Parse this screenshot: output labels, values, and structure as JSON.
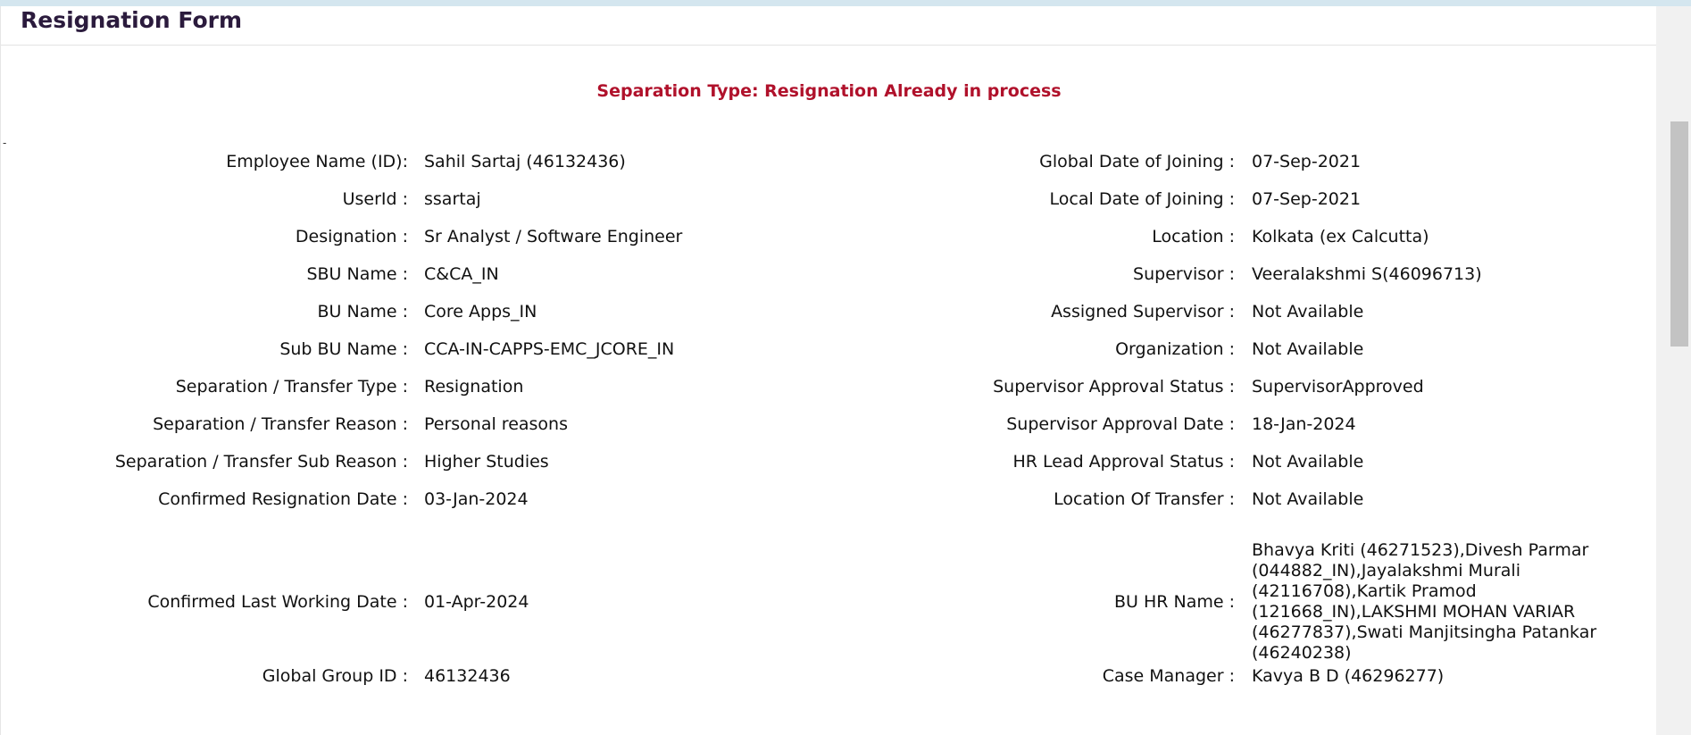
{
  "form": {
    "title": "Resignation Form",
    "status_banner": "Separation Type: Resignation Already in process",
    "tiny_mark": "-"
  },
  "left": [
    {
      "label": "Employee Name (ID):",
      "value": "Sahil Sartaj (46132436)"
    },
    {
      "label": "UserId :",
      "value": "ssartaj"
    },
    {
      "label": "Designation :",
      "value": "Sr Analyst / Software Engineer"
    },
    {
      "label": "SBU Name :",
      "value": "C&CA_IN"
    },
    {
      "label": "BU Name :",
      "value": "Core Apps_IN"
    },
    {
      "label": "Sub BU Name :",
      "value": "CCA-IN-CAPPS-EMC_JCORE_IN"
    },
    {
      "label": "Separation / Transfer Type :",
      "value": "Resignation"
    },
    {
      "label": "Separation / Transfer Reason :",
      "value": "Personal reasons"
    },
    {
      "label": "Separation / Transfer Sub Reason :",
      "value": "Higher Studies"
    },
    {
      "label": "Confirmed Resignation Date :",
      "value": "03-Jan-2024"
    },
    {
      "label": "Confirmed Last Working Date :",
      "value": "01-Apr-2024"
    },
    {
      "label": "Global Group ID :",
      "value": "46132436"
    }
  ],
  "right": [
    {
      "label": "Global Date of Joining :",
      "value": "07-Sep-2021"
    },
    {
      "label": "Local Date of Joining :",
      "value": "07-Sep-2021"
    },
    {
      "label": "Location :",
      "value": "Kolkata (ex Calcutta)"
    },
    {
      "label": "Supervisor :",
      "value": "Veeralakshmi S(46096713)"
    },
    {
      "label": "Assigned Supervisor :",
      "value": "Not Available"
    },
    {
      "label": "Organization :",
      "value": "Not Available"
    },
    {
      "label": "Supervisor Approval Status :",
      "value": "SupervisorApproved"
    },
    {
      "label": "Supervisor Approval Date :",
      "value": "18-Jan-2024"
    },
    {
      "label": "HR Lead Approval Status :",
      "value": "Not Available"
    },
    {
      "label": "Location Of Transfer :",
      "value": "Not Available"
    },
    {
      "label": "BU HR Name :",
      "value": "Bhavya Kriti (46271523),Divesh Parmar (044882_IN),Jayalakshmi Murali (42116708),Kartik Pramod (121668_IN),LAKSHMI MOHAN VARIAR (46277837),Swati Manjitsingha Patankar (46240238)"
    },
    {
      "label": "Case Manager :",
      "value": "Kavya B D (46296277)"
    }
  ]
}
